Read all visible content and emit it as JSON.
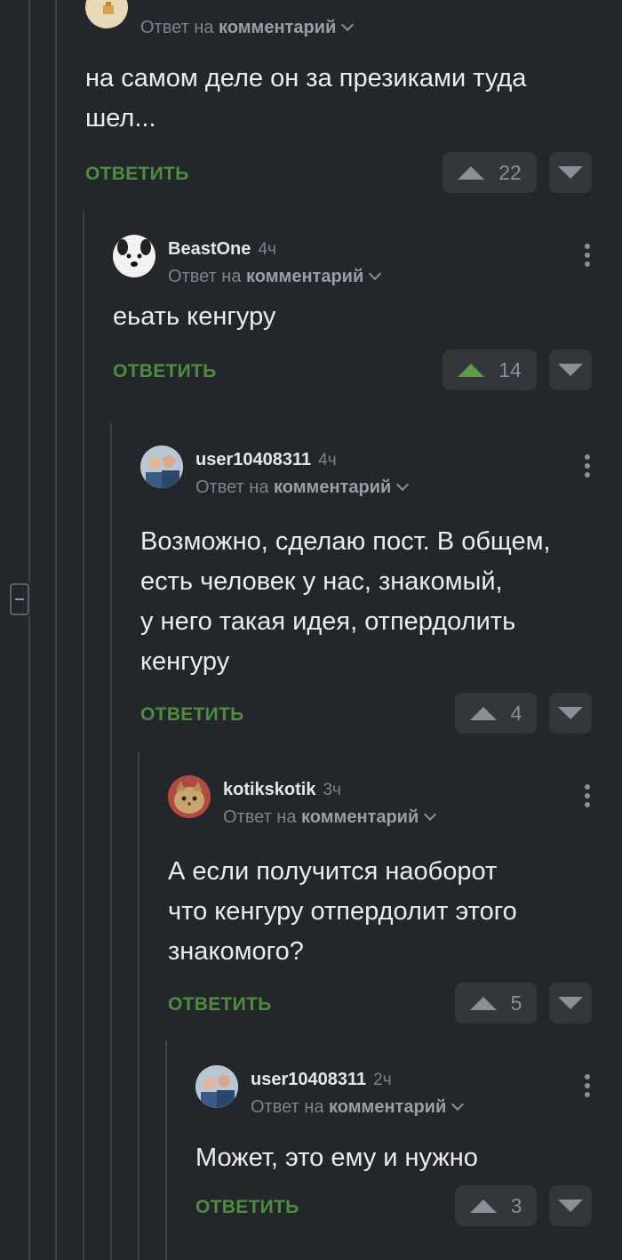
{
  "top": {
    "reply_prefix": "Ответ на",
    "reply_target": "комментарий",
    "text": "на самом деле он за презиками туда шел...",
    "reply_label": "ОТВЕТИТЬ",
    "votes": "22"
  },
  "comments": [
    {
      "username": "BeastOne",
      "time": "4ч",
      "reply_prefix": "Ответ на",
      "reply_target": "комментарий",
      "text": "еьать кенгуру",
      "reply_label": "ОТВЕТИТЬ",
      "votes": "14"
    },
    {
      "username": "user10408311",
      "time": "4ч",
      "reply_prefix": "Ответ на",
      "reply_target": "комментарий",
      "text_lines": [
        "Возможно, сделаю пост. В общем,",
        "есть человек у нас, знакомый,",
        "у него такая идея, отпердолить",
        "кенгуру"
      ],
      "reply_label": "ОТВЕТИТЬ",
      "votes": "4"
    },
    {
      "username": "kotikskotik",
      "time": "3ч",
      "reply_prefix": "Ответ на",
      "reply_target": "комментарий",
      "text_lines": [
        "А если получится наоборот",
        "что кенгуру отпердолит этого",
        "знакомого?"
      ],
      "reply_label": "ОТВЕТИТЬ",
      "votes": "5"
    },
    {
      "username": "user10408311",
      "time": "2ч",
      "reply_prefix": "Ответ на",
      "reply_target": "комментарий",
      "text": "Может, это ему и нужно",
      "reply_label": "ОТВЕТИТЬ",
      "votes": "3"
    }
  ],
  "colors": {
    "background": "#23262a",
    "accent_green": "#4e8c3f",
    "upvoted_green": "#5f9b4a",
    "muted": "#7d838a"
  }
}
